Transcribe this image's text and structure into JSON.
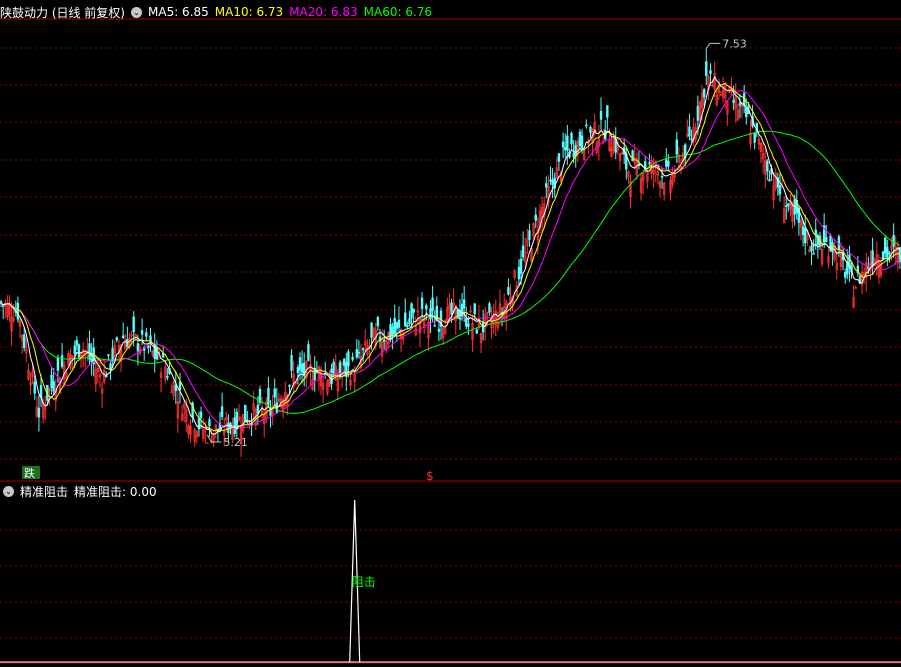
{
  "main_panel": {
    "title": "陕鼓动力 (日线 前复权)",
    "ma_labels": [
      {
        "text": "MA5: 6.85",
        "color": "#ffffff"
      },
      {
        "text": "MA10: 6.73",
        "color": "#ffff00"
      },
      {
        "text": "MA20: 6.83",
        "color": "#ff00ff"
      },
      {
        "text": "MA60: 6.76",
        "color": "#00ff00"
      }
    ],
    "high_label": "7.53",
    "low_label": "5.21",
    "left_marker": "跌",
    "mid_marker": "$"
  },
  "sub_panel": {
    "title": "精准阻击",
    "value_label": "精准阻击: 0.00",
    "signal_label": "阻击"
  },
  "colors": {
    "up": "#ff3232",
    "down": "#54ffff",
    "ma5": "#ffffff",
    "ma10": "#ffff00",
    "ma20": "#ff00ff",
    "ma60": "#00ff00",
    "grid": "#8b0000",
    "signal": "#ffffff",
    "signal_label": "#00ff00"
  },
  "chart_data": {
    "type": "candlestick",
    "y_range": [
      5.0,
      7.7
    ],
    "grid": true,
    "price_keypoints": [
      [
        0,
        6.0
      ],
      [
        8,
        5.95
      ],
      [
        18,
        5.35
      ],
      [
        28,
        5.6
      ],
      [
        38,
        5.75
      ],
      [
        48,
        5.55
      ],
      [
        58,
        5.8
      ],
      [
        68,
        5.75
      ],
      [
        78,
        5.62
      ],
      [
        88,
        5.35
      ],
      [
        98,
        5.22
      ],
      [
        108,
        5.27
      ],
      [
        118,
        5.33
      ],
      [
        128,
        5.35
      ],
      [
        138,
        5.55
      ],
      [
        148,
        5.6
      ],
      [
        158,
        5.55
      ],
      [
        168,
        5.62
      ],
      [
        178,
        5.8
      ],
      [
        188,
        5.82
      ],
      [
        198,
        5.92
      ],
      [
        208,
        5.9
      ],
      [
        218,
        5.95
      ],
      [
        228,
        5.85
      ],
      [
        238,
        5.95
      ],
      [
        248,
        6.25
      ],
      [
        258,
        6.6
      ],
      [
        268,
        6.9
      ],
      [
        278,
        7.0
      ],
      [
        288,
        7.05
      ],
      [
        298,
        6.8
      ],
      [
        308,
        6.82
      ],
      [
        318,
        6.75
      ],
      [
        328,
        7.0
      ],
      [
        335,
        7.35
      ],
      [
        345,
        7.25
      ],
      [
        355,
        7.1
      ],
      [
        365,
        6.8
      ],
      [
        375,
        6.55
      ],
      [
        385,
        6.35
      ],
      [
        395,
        6.35
      ],
      [
        405,
        6.1
      ],
      [
        415,
        6.3
      ],
      [
        425,
        6.3
      ]
    ],
    "high": {
      "value": 7.53,
      "bar": 335
    },
    "low": {
      "value": 5.21,
      "bar": 98
    },
    "latest_ma": {
      "MA5": 6.85,
      "MA10": 6.73,
      "MA20": 6.83,
      "MA60": 6.76
    },
    "indicator": {
      "name": "精准阻击",
      "value": 0.0,
      "spike_bar": 168,
      "spike_value": 1.0
    }
  }
}
